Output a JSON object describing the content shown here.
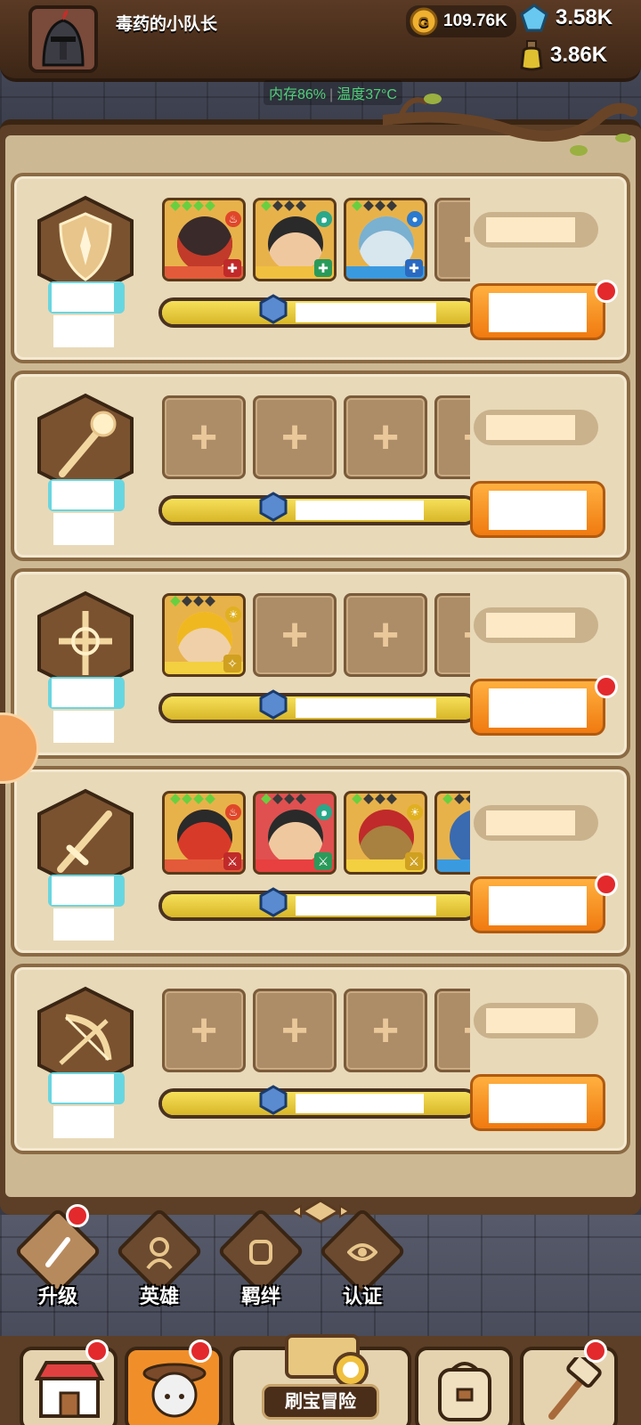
{
  "header": {
    "player_name": "毒药的小队长",
    "gold": "109.76K",
    "gems": "3.58K",
    "potion": "3.86K"
  },
  "status": {
    "memory": "内存86%",
    "temperature": "温度37°C"
  },
  "colors": {
    "accent_orange": "#f07a10",
    "red_dot": "#e3292c",
    "bar_fill": "#d8b628",
    "panel_bg": "#ccb994"
  },
  "squads": [
    {
      "class_icon": "shield-icon",
      "heroes": [
        {
          "element": "fire",
          "role": "tank"
        },
        {
          "element": "wind",
          "role": "tank"
        },
        {
          "element": "water",
          "role": "tank"
        }
      ],
      "empty_slot_icon": "plus-icon",
      "red_dot": true,
      "progress": 0.36
    },
    {
      "class_icon": "staff-icon",
      "heroes": [],
      "empty_slot_icon": "plus-icon",
      "red_dot": false,
      "progress": 0.36
    },
    {
      "class_icon": "crossbow-icon",
      "heroes": [
        {
          "element": "light",
          "role": "support"
        }
      ],
      "empty_slot_icon": "plus-icon",
      "red_dot": true,
      "progress": 0.36
    },
    {
      "class_icon": "sword-icon",
      "heroes": [
        {
          "element": "fire",
          "role": "melee"
        },
        {
          "element": "wind",
          "role": "melee"
        },
        {
          "element": "light",
          "role": "melee"
        },
        {
          "element": "water",
          "role": "melee"
        }
      ],
      "empty_slot_icon": "plus-icon",
      "red_dot": true,
      "progress": 0.36
    },
    {
      "class_icon": "bow-icon",
      "heroes": [],
      "empty_slot_icon": "plus-icon",
      "red_dot": false,
      "progress": 0.36
    }
  ],
  "tabs": [
    {
      "label": "升级",
      "icon": "sword-icon",
      "red_dot": true
    },
    {
      "label": "英雄",
      "icon": "hero-icon",
      "red_dot": false
    },
    {
      "label": "羁绊",
      "icon": "fist-icon",
      "red_dot": false
    },
    {
      "label": "认证",
      "icon": "eye-icon",
      "red_dot": false
    }
  ],
  "nav": {
    "shop_icon": "shop-icon",
    "hero_icon": "hero-portrait-icon",
    "adventure_label": "刷宝冒险",
    "bag_icon": "backpack-icon",
    "forge_icon": "hammer-icon"
  }
}
